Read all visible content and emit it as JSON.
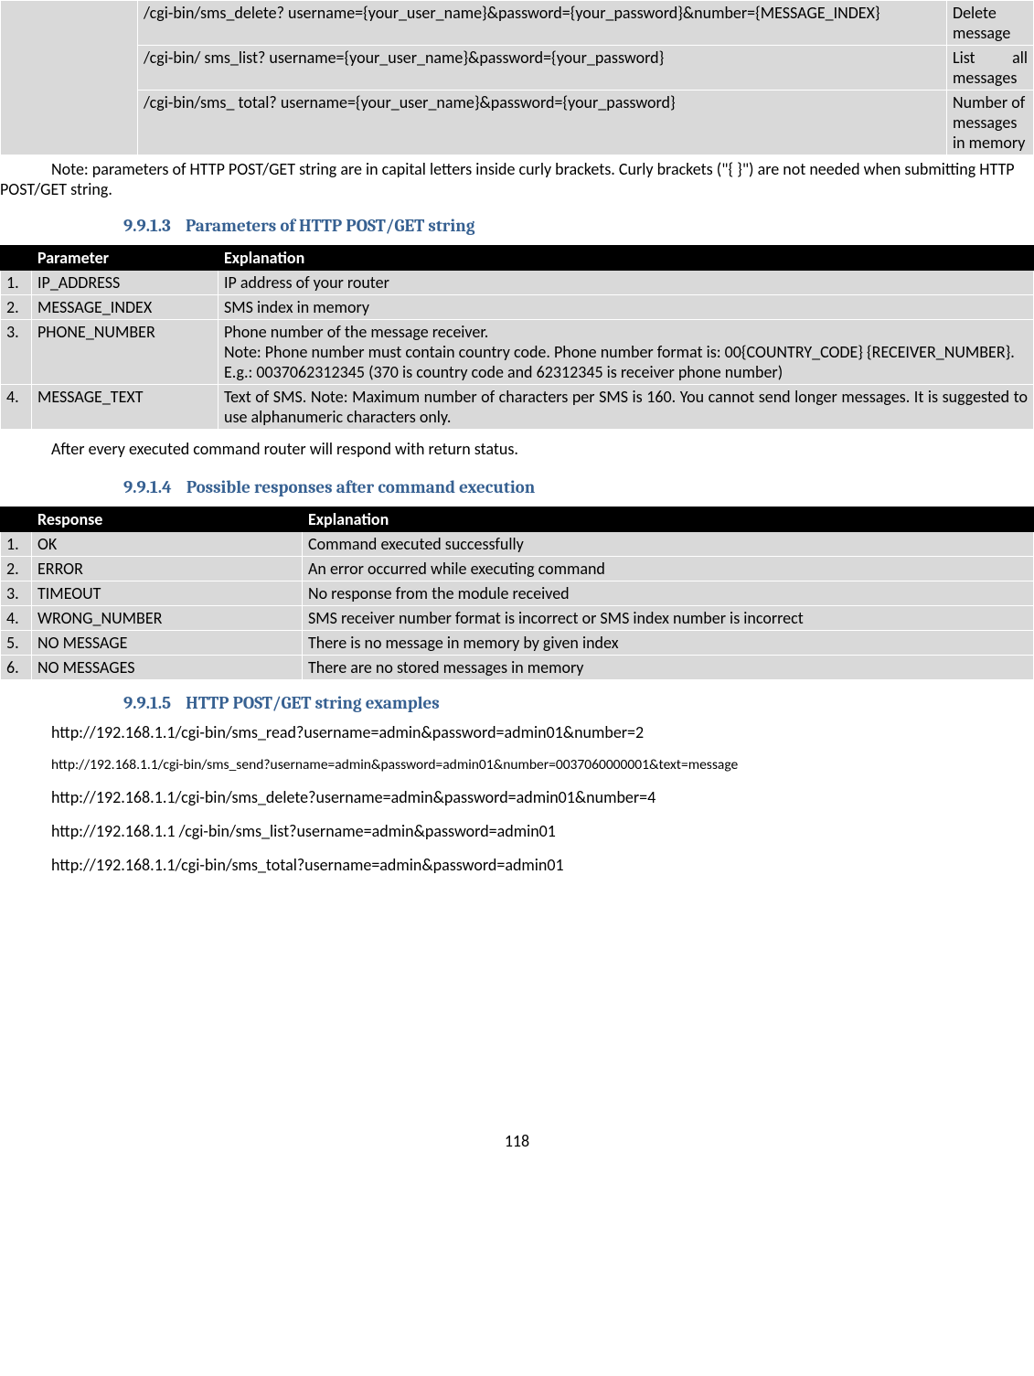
{
  "endpoints": [
    {
      "url": "/cgi-bin/sms_delete? username={your_user_name}&password={your_password}&number={MESSAGE_INDEX}",
      "desc": "Delete message"
    },
    {
      "url": "/cgi-bin/ sms_list? username={your_user_name}&password={your_password}",
      "desc": "List all messages"
    },
    {
      "url": "/cgi-bin/sms_ total? username={your_user_name}&password={your_password}",
      "desc": "Number of messages in memory"
    }
  ],
  "note": "Note: parameters of HTTP POST/GET string are in capital letters inside curly brackets. Curly brackets (\"{ }\") are not needed when submitting HTTP POST/GET string.",
  "section1": {
    "num": "9.9.1.3",
    "title": "Parameters of HTTP POST/GET string"
  },
  "paramHeaders": {
    "p": "Parameter",
    "e": "Explanation"
  },
  "params": [
    {
      "n": "1.",
      "p": "IP_ADDRESS",
      "e": "IP address of your router"
    },
    {
      "n": "2.",
      "p": "MESSAGE_INDEX",
      "e": "SMS index in memory"
    },
    {
      "n": "3.",
      "p": "PHONE_NUMBER",
      "e": "Phone number of the message receiver.\nNote: Phone number must contain country code. Phone number format is: 00{COUNTRY_CODE} {RECEIVER_NUMBER}.\nE.g.: 0037062312345 (370 is country code and 62312345 is receiver phone number)"
    },
    {
      "n": "4.",
      "p": "MESSAGE_TEXT",
      "e": "Text of SMS. Note: Maximum number of characters per SMS is 160. You cannot send longer messages. It is suggested to use alphanumeric characters only."
    }
  ],
  "afterParams": "After every executed command router will respond with return status.",
  "section2": {
    "num": "9.9.1.4",
    "title": "Possible responses after command execution"
  },
  "respHeaders": {
    "r": "Response",
    "e": "Explanation"
  },
  "responses": [
    {
      "n": "1.",
      "r": "OK",
      "e": "Command executed successfully"
    },
    {
      "n": "2.",
      "r": "ERROR",
      "e": "An error occurred while executing command"
    },
    {
      "n": "3.",
      "r": "TIMEOUT",
      "e": "No response from the module received"
    },
    {
      "n": "4.",
      "r": "WRONG_NUMBER",
      "e": "SMS receiver number format is incorrect or SMS index number is incorrect"
    },
    {
      "n": "5.",
      "r": "NO MESSAGE",
      "e": "There is no message in memory by given index"
    },
    {
      "n": "6.",
      "r": "NO MESSAGES",
      "e": "There are no stored messages in memory"
    }
  ],
  "section3": {
    "num": "9.9.1.5",
    "title": "HTTP POST/GET string examples"
  },
  "examples": [
    {
      "text": "http://192.168.1.1/cgi-bin/sms_read?username=admin&password=admin01&number=2",
      "small": false
    },
    {
      "text": "http://192.168.1.1/cgi-bin/sms_send?username=admin&password=admin01&number=0037060000001&text=message",
      "small": true
    },
    {
      "text": "http://192.168.1.1/cgi-bin/sms_delete?username=admin&password=admin01&number=4",
      "small": false
    },
    {
      "text": "http://192.168.1.1 /cgi-bin/sms_list?username=admin&password=admin01",
      "small": false
    },
    {
      "text": "http://192.168.1.1/cgi-bin/sms_total?username=admin&password=admin01",
      "small": false
    }
  ],
  "pageNumber": "118"
}
